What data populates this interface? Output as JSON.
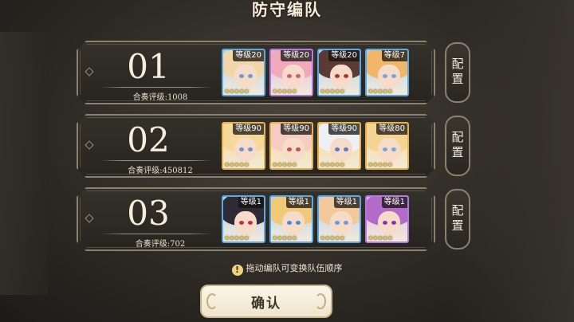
{
  "title": "防守编队",
  "teams": [
    {
      "number": "01",
      "score_label": "合奏评级:1008",
      "members": [
        {
          "level": "等级20",
          "frame": "blue",
          "hair": "#f1d7a8",
          "eye": "#6a9bd6"
        },
        {
          "level": "等级20",
          "frame": "purple",
          "hair": "#f1a9bc",
          "eye": "#d05a7a"
        },
        {
          "level": "等级20",
          "frame": "blue",
          "hair": "#5a3a34",
          "eye": "#b93030"
        },
        {
          "level": "等级7",
          "frame": "blue",
          "hair": "#f0b768",
          "eye": "#7aa4d8"
        }
      ]
    },
    {
      "number": "02",
      "score_label": "合奏评级:450812",
      "members": [
        {
          "level": "等级90",
          "frame": "gold",
          "hair": "#f6d99a",
          "eye": "#6f8fcf"
        },
        {
          "level": "等级90",
          "frame": "gold",
          "hair": "#f4ccc4",
          "eye": "#c05060"
        },
        {
          "level": "等级90",
          "frame": "gold",
          "hair": "#eef0f5",
          "eye": "#5f78c8"
        },
        {
          "level": "等级80",
          "frame": "gold",
          "hair": "#f4d490",
          "eye": "#7aa4d8"
        }
      ]
    },
    {
      "number": "03",
      "score_label": "合奏评级:702",
      "members": [
        {
          "level": "等级1",
          "frame": "blue",
          "hair": "#2e2a36",
          "eye": "#c03050"
        },
        {
          "level": "等级1",
          "frame": "blue",
          "hair": "#f2c978",
          "eye": "#4d86d8"
        },
        {
          "level": "等级1",
          "frame": "blue",
          "hair": "#f3c89a",
          "eye": "#6a9bd6"
        },
        {
          "level": "等级1",
          "frame": "purple",
          "hair": "#b46ac8",
          "eye": "#8a3aa8"
        }
      ]
    }
  ],
  "config_label": "配置",
  "hint_text": "拖动编队可变换队伍顺序",
  "hint_icon": "!",
  "confirm_label": "确认",
  "stars": "★★★★★"
}
